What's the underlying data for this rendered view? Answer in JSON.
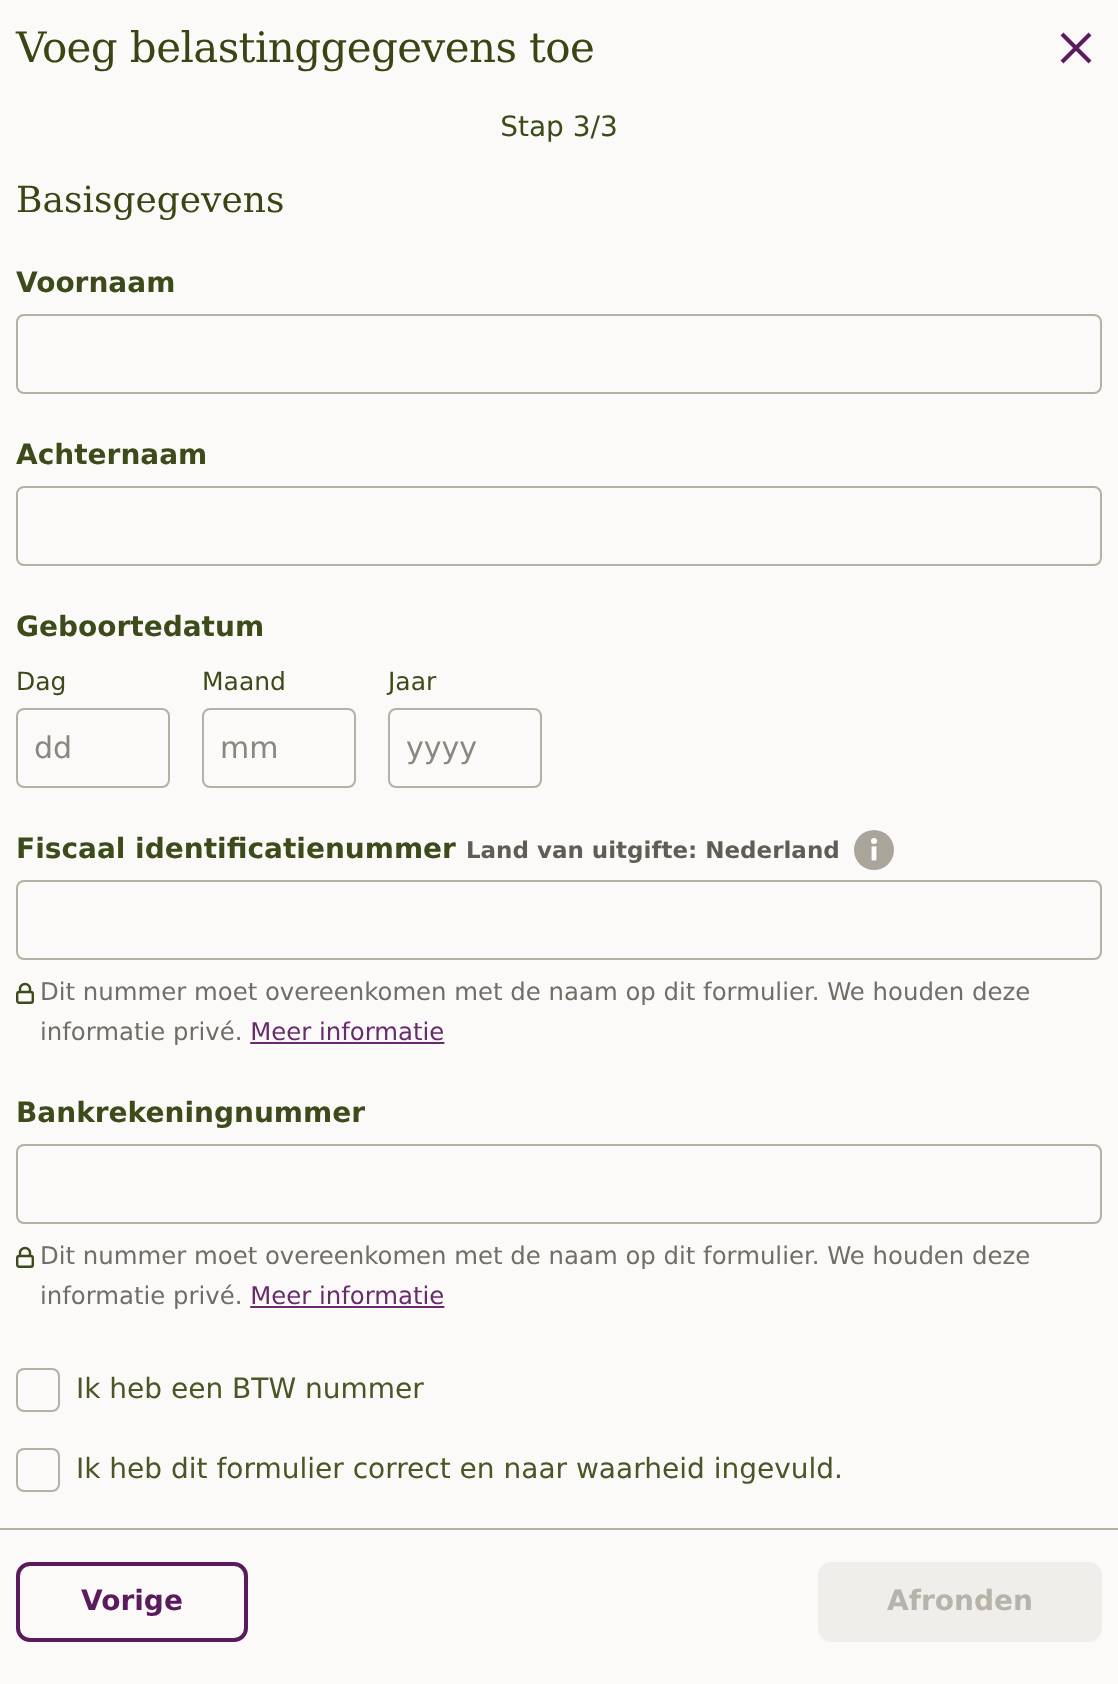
{
  "dialog": {
    "title": "Voeg belastinggegevens toe",
    "step": "Stap 3/3"
  },
  "section_title": "Basisgegevens",
  "fields": [
    {
      "kind": "text",
      "label": "Voornaam"
    },
    {
      "kind": "text",
      "label": "Achternaam"
    },
    {
      "kind": "date",
      "label": "Geboortedatum",
      "parts": [
        {
          "label": "Dag",
          "placeholder": "dd"
        },
        {
          "label": "Maand",
          "placeholder": "mm"
        },
        {
          "label": "Jaar",
          "placeholder": "yyyy"
        }
      ]
    },
    {
      "kind": "text",
      "label": "Fiscaal identificatienummer",
      "sublabel": "Land van uitgifte: Nederland",
      "info": true,
      "hint": "Dit nummer moet overeenkomen met de naam op dit formulier. We houden deze informatie privé.",
      "hint_link": "Meer informatie"
    },
    {
      "kind": "text",
      "label": "Bankrekeningnummer",
      "hint": "Dit nummer moet overeenkomen met de naam op dit formulier. We houden deze informatie privé.",
      "hint_link": "Meer informatie"
    }
  ],
  "checkboxes": [
    {
      "label": "Ik heb een BTW nummer",
      "checked": false
    },
    {
      "label": "Ik heb dit formulier correct en naar waarheid ingevuld.",
      "checked": false
    }
  ],
  "buttons": [
    {
      "label": "Vorige",
      "disabled": false
    },
    {
      "label": "Afronden",
      "disabled": true
    }
  ]
}
